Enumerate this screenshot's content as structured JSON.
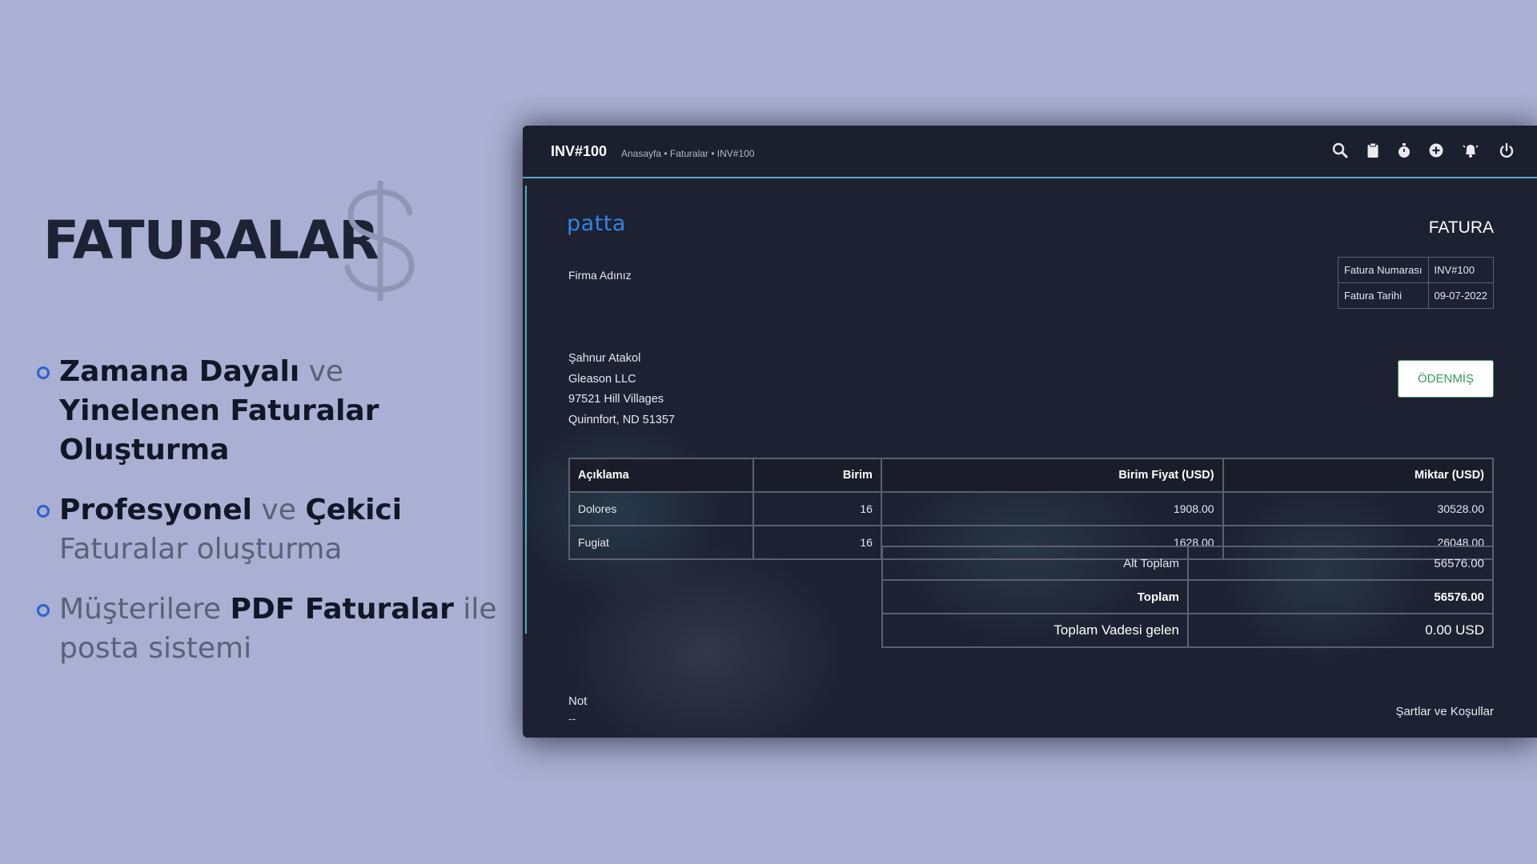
{
  "promo": {
    "title": "FATURALAR",
    "features": [
      [
        {
          "text": "Zamana Dayalı",
          "bold": true
        },
        {
          "text": " ve ",
          "bold": false
        },
        {
          "text": "Yinelenen Faturalar Oluşturma",
          "bold": true
        }
      ],
      [
        {
          "text": "Profesyonel",
          "bold": true
        },
        {
          "text": " ve ",
          "bold": false
        },
        {
          "text": "Çekici",
          "bold": true
        },
        {
          "text": " Faturalar oluşturma",
          "bold": false
        }
      ],
      [
        {
          "text": "Müşterilere ",
          "bold": false
        },
        {
          "text": "PDF Faturalar",
          "bold": true
        },
        {
          "text": " ile posta sistemi",
          "bold": false
        }
      ]
    ]
  },
  "app": {
    "title": "INV#100",
    "breadcrumb": "Anasayfa • Faturalar • INV#100",
    "toolbar_icons": [
      "search-icon",
      "clipboard-icon",
      "stopwatch-icon",
      "plus-circle-icon",
      "bell-icon",
      "power-icon"
    ]
  },
  "invoice": {
    "logo_text": "patta",
    "company_name": "Firma Adınız",
    "heading": "FATURA",
    "meta": [
      {
        "label": "Fatura Numarası",
        "value": "INV#100"
      },
      {
        "label": "Fatura Tarihi",
        "value": "09-07-2022"
      }
    ],
    "status": "ÖDENMİŞ",
    "billing": {
      "name": "Şahnur Atakol",
      "company": "Gleason LLC",
      "street": "97521 Hill Villages",
      "city": "Quinnfort, ND 51357"
    },
    "columns": [
      "Açıklama",
      "Birim",
      "Birim Fiyat (USD)",
      "Miktar (USD)"
    ],
    "items": [
      [
        "Dolores",
        "16",
        "1908.00",
        "30528.00"
      ],
      [
        "Fugiat",
        "16",
        "1628.00",
        "26048.00"
      ]
    ],
    "totals": [
      {
        "label": "Alt Toplam",
        "value": "56576.00",
        "style": ""
      },
      {
        "label": "Toplam",
        "value": "56576.00",
        "style": "bold"
      },
      {
        "label": "Toplam Vadesi gelen",
        "value": "0.00 USD",
        "style": "big"
      }
    ],
    "note_label": "Not",
    "note_value": "--",
    "terms_label": "Şartlar ve Koşullar"
  },
  "colors": {
    "page_background": "#a9b0d3",
    "window_background": "#1d2132",
    "accent": "#57a8c4",
    "logo": "#2f86e0",
    "paid_status": "#3a9b57",
    "bullet": "#2b62d1"
  }
}
